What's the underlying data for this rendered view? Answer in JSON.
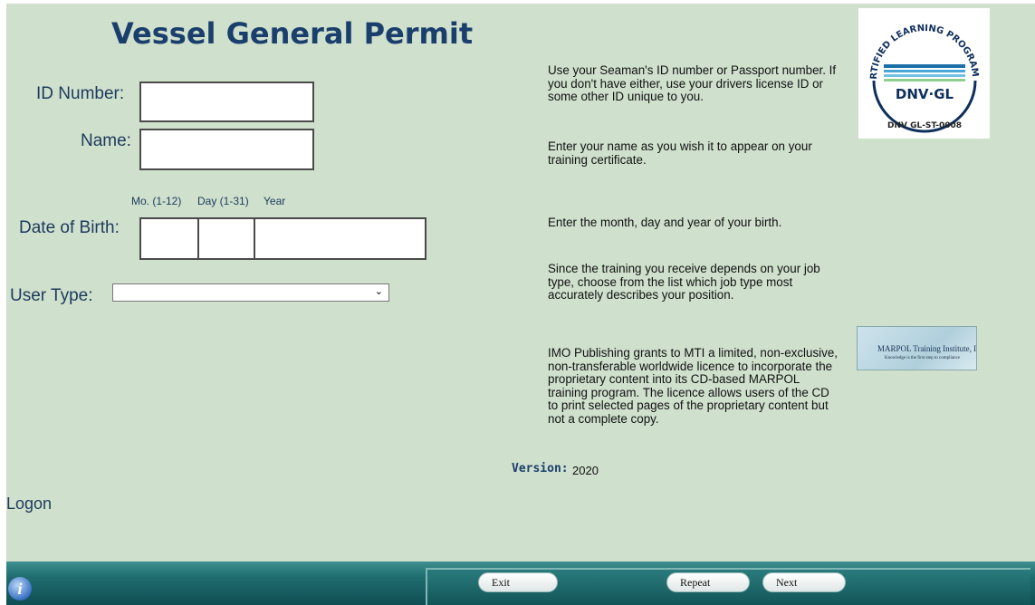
{
  "title": "Vessel General Permit",
  "form": {
    "id_label": "ID Number:",
    "name_label": "Name:",
    "dob_label": "Date of Birth:",
    "dob_hint_month": "Mo. (1-12)",
    "dob_hint_day": "Day (1-31)",
    "dob_hint_year": "Year",
    "user_type_label": "User Type:",
    "user_type_value": ""
  },
  "help": {
    "id": "Use your Seaman's ID number or Passport number. If you don't have either, use your drivers license ID or some other ID unique to you.",
    "name": "Enter your name as you wish it to appear on your training certificate.",
    "dob": "Enter the month, day and year of your birth.",
    "user_type": "Since the training you receive depends on your job type, choose from the list which job type most accurately describes your position.",
    "license": "IMO Publishing grants to MTI a limited, non-exclusive, non-transferable worldwide licence to incorporate the proprietary content into its CD-based MARPOL training program. The licence allows users of the CD to print selected pages of the proprietary content but not a complete copy."
  },
  "logos": {
    "dnv_arc": "CERTIFIED LEARNING PROGRAMME",
    "dnv_name": "DNV·GL",
    "dnv_standard": "DNV GL-ST-0008",
    "marpol_name": "MARPOL Training Institute, Inc.",
    "marpol_tagline": "Knowledge is the first step to compliance"
  },
  "version": {
    "label": "Version:",
    "value": "2020"
  },
  "section": "Logon",
  "buttons": {
    "exit": "Exit",
    "repeat": "Repeat",
    "next": "Next"
  },
  "icons": {
    "info": "info-icon"
  }
}
